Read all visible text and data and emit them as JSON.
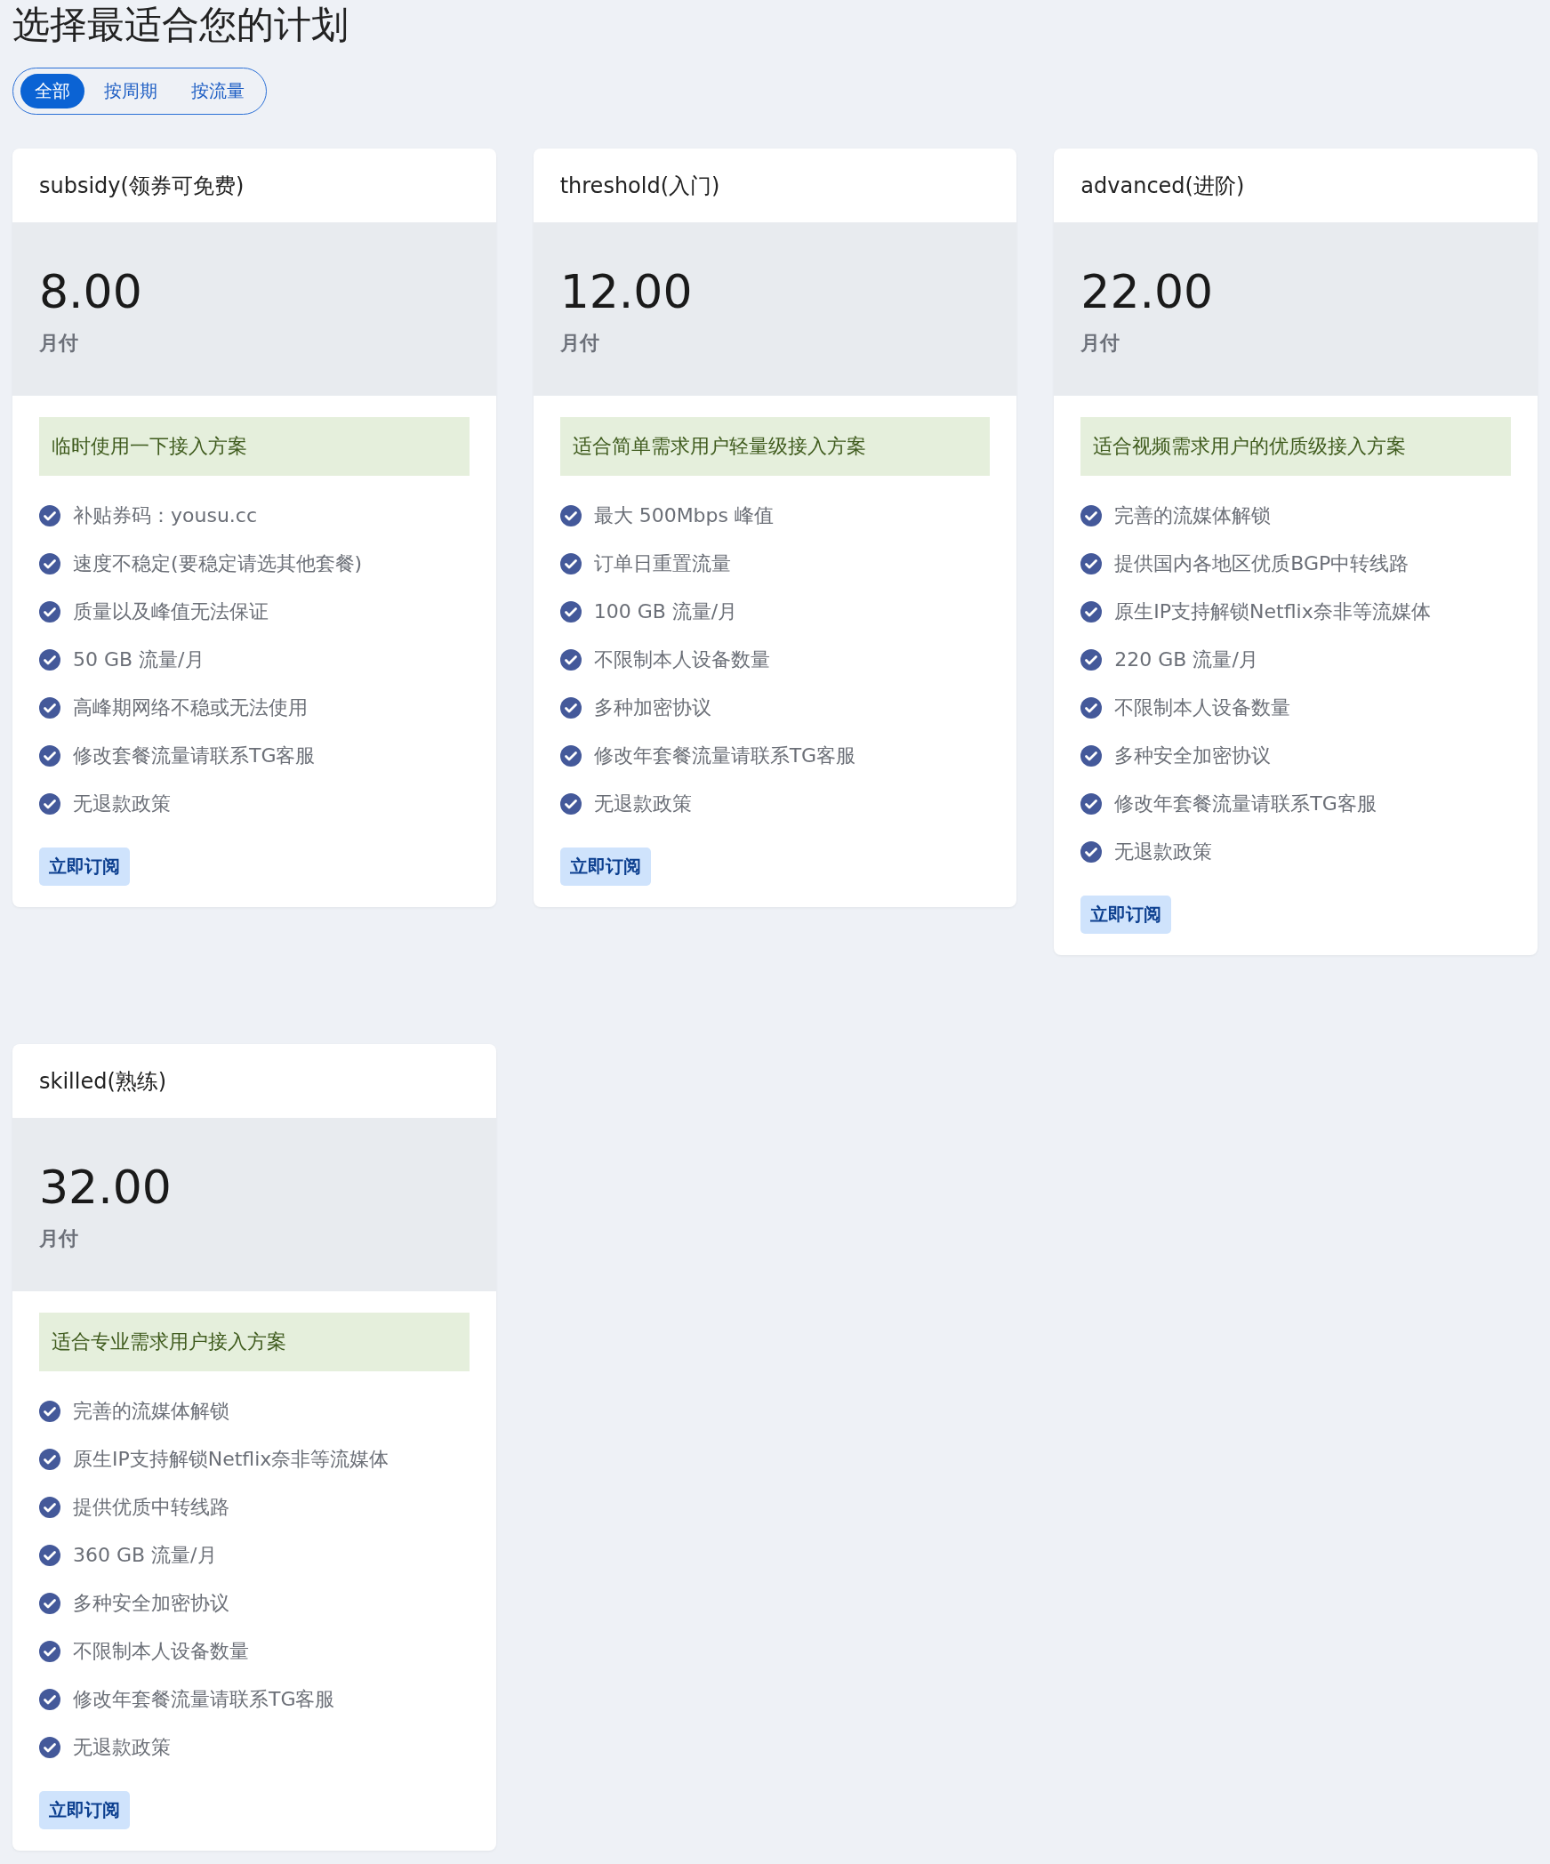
{
  "title": "选择最适合您的计划",
  "tabs": [
    {
      "label": "全部",
      "selected": true
    },
    {
      "label": "按周期",
      "selected": false
    },
    {
      "label": "按流量",
      "selected": false
    }
  ],
  "plans": [
    {
      "name": "subsidy(领券可免费)",
      "price": "8.00",
      "period": "月付",
      "summary": "临时使用一下接入方案",
      "features": [
        "补贴券码：yousu.cc",
        "速度不稳定(要稳定请选其他套餐)",
        "质量以及峰值无法保证",
        "50 GB 流量/月",
        "高峰期网络不稳或无法使用",
        "修改套餐流量请联系TG客服",
        "无退款政策"
      ],
      "button": "立即订阅"
    },
    {
      "name": "threshold(入门)",
      "price": "12.00",
      "period": "月付",
      "summary": "适合简单需求用户轻量级接入方案",
      "features": [
        "最大 500Mbps 峰值",
        "订单日重置流量",
        "100 GB 流量/月",
        "不限制本人设备数量",
        "多种加密协议",
        "修改年套餐流量请联系TG客服",
        "无退款政策"
      ],
      "button": "立即订阅"
    },
    {
      "name": "advanced(进阶)",
      "price": "22.00",
      "period": "月付",
      "summary": "适合视频需求用户的优质级接入方案",
      "features": [
        "完善的流媒体解锁",
        "提供国内各地区优质BGP中转线路",
        "原生IP支持解锁Netflix奈非等流媒体",
        "220 GB 流量/月",
        "不限制本人设备数量",
        "多种安全加密协议",
        "修改年套餐流量请联系TG客服",
        "无退款政策"
      ],
      "button": "立即订阅"
    },
    {
      "name": "skilled(熟练)",
      "price": "32.00",
      "period": "月付",
      "summary": "适合专业需求用户接入方案",
      "features": [
        "完善的流媒体解锁",
        "原生IP支持解锁Netflix奈非等流媒体",
        "提供优质中转线路",
        "360 GB 流量/月",
        "多种安全加密协议",
        "不限制本人设备数量",
        "修改年套餐流量请联系TG客服",
        "无退款政策"
      ],
      "button": "立即订阅"
    }
  ]
}
